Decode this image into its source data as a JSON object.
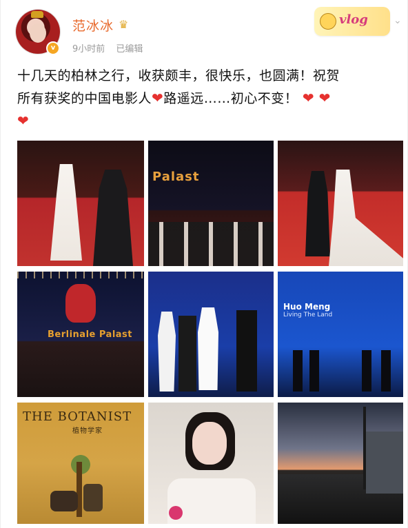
{
  "post": {
    "author": {
      "name": "范冰冰",
      "verified": true
    },
    "meta": {
      "time": "9小时前",
      "edited": "已编辑"
    },
    "badge": {
      "text": "vlog"
    },
    "text_lines": [
      "十几天的柏林之行，收获颇丰，很快乐，也圆满！祝贺",
      "所有获奖的中国电影人",
      "路遥远……初心不变！"
    ],
    "emoji": {
      "heart": "❤"
    }
  },
  "photos": [
    {
      "caption": ""
    },
    {
      "caption": "Palast"
    },
    {
      "caption": ""
    },
    {
      "caption": "Berlinale Palast"
    },
    {
      "caption": ""
    },
    {
      "title": "Huo Meng",
      "subtitle": "Living The Land"
    },
    {
      "title": "THE BOTANIST",
      "subtitle": "植物学家"
    },
    {
      "caption": ""
    },
    {
      "caption": ""
    }
  ],
  "icons": {
    "verified": "verified-badge-icon",
    "crown": "crown-icon",
    "chevron": "chevron-down-icon"
  },
  "colors": {
    "username": "#e86a2d",
    "heart": "#e6312f"
  }
}
